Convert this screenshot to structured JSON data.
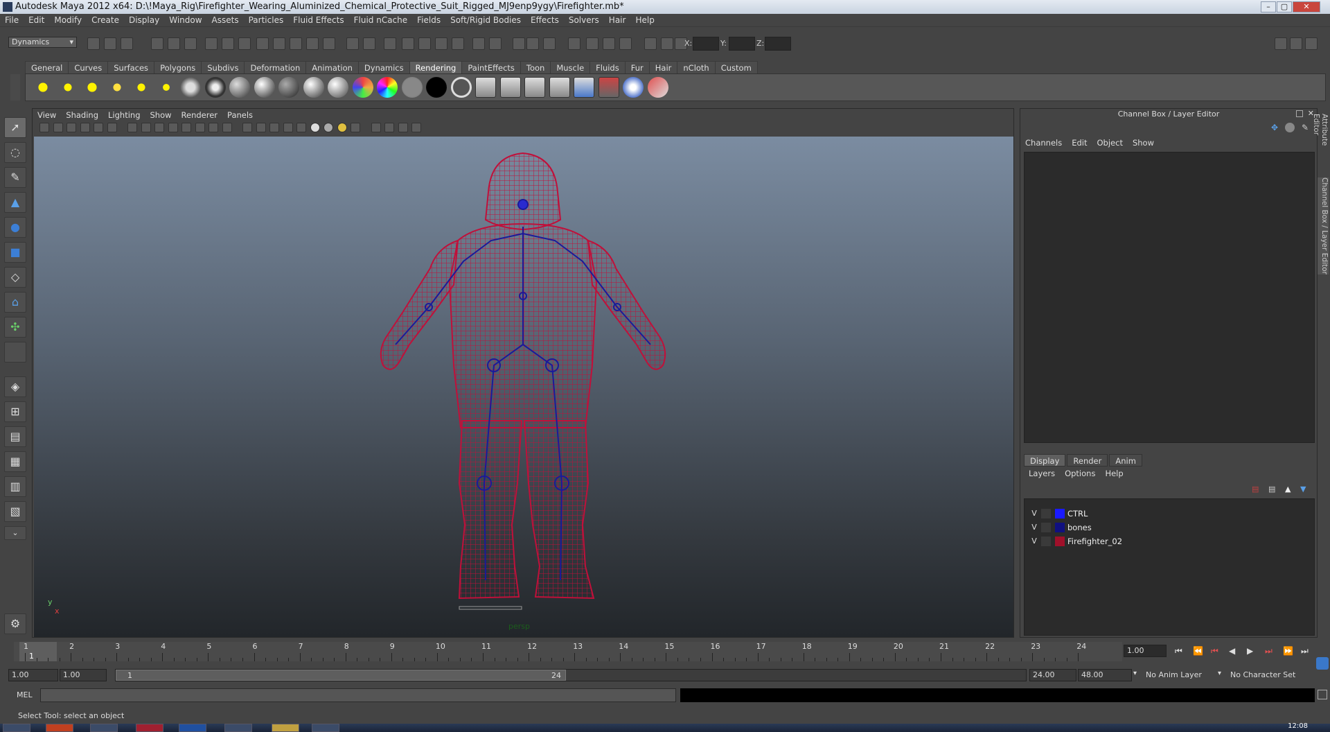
{
  "window": {
    "title": "Autodesk Maya 2012 x64: D:\\!Maya_Rig\\Firefighter_Wearing_Aluminized_Chemical_Protective_Suit_Rigged_MJ9enp9ygy\\Firefighter.mb*"
  },
  "menubar": [
    "File",
    "Edit",
    "Modify",
    "Create",
    "Display",
    "Window",
    "Assets",
    "Particles",
    "Fluid Effects",
    "Fluid nCache",
    "Fields",
    "Soft/Rigid Bodies",
    "Effects",
    "Solvers",
    "Hair",
    "Help"
  ],
  "statusline": {
    "mode": "Dynamics",
    "x_label": "X:",
    "y_label": "Y:",
    "z_label": "Z:"
  },
  "shelf": {
    "tabs": [
      "General",
      "Curves",
      "Surfaces",
      "Polygons",
      "Subdivs",
      "Deformation",
      "Animation",
      "Dynamics",
      "Rendering",
      "PaintEffects",
      "Toon",
      "Muscle",
      "Fluids",
      "Fur",
      "Hair",
      "nCloth",
      "Custom"
    ],
    "active_tab": "Rendering"
  },
  "viewport": {
    "menu": [
      "View",
      "Shading",
      "Lighting",
      "Show",
      "Renderer",
      "Panels"
    ],
    "camera_label": "persp",
    "axis_y": "y",
    "axis_x": "x",
    "wire_color": "#c0103a",
    "bone_color": "#1a1a9a"
  },
  "channel_box": {
    "title": "Channel Box / Layer Editor",
    "menu": [
      "Channels",
      "Edit",
      "Object",
      "Show"
    ]
  },
  "layer_editor": {
    "tabs": [
      "Display",
      "Render",
      "Anim"
    ],
    "active_tab": "Display",
    "menu": [
      "Layers",
      "Options",
      "Help"
    ],
    "layers": [
      {
        "v": "V",
        "name": "CTRL",
        "color": "#1a1aff"
      },
      {
        "v": "V",
        "name": "bones",
        "color": "#101080"
      },
      {
        "v": "V",
        "name": "Firefighter_02",
        "color": "#a0102a"
      }
    ]
  },
  "side_tabs": [
    "Attribute Editor",
    "Channel Box / Layer Editor"
  ],
  "timeline": {
    "ticks": [
      "1",
      "2",
      "3",
      "4",
      "5",
      "6",
      "7",
      "8",
      "9",
      "10",
      "11",
      "12",
      "13",
      "14",
      "15",
      "16",
      "17",
      "18",
      "19",
      "20",
      "21",
      "22",
      "23",
      "24"
    ],
    "current_frame": "1",
    "current_time_field": "1.00"
  },
  "range": {
    "start": "1.00",
    "playback_start": "1.00",
    "slider_start": "1",
    "slider_end": "24",
    "playback_end": "24.00",
    "end": "48.00",
    "anim_layer": "No Anim Layer",
    "character_set": "No Character Set"
  },
  "mel": {
    "label": "MEL"
  },
  "help_line": "Select Tool: select an object",
  "taskbar": {
    "clock": "12:08"
  }
}
